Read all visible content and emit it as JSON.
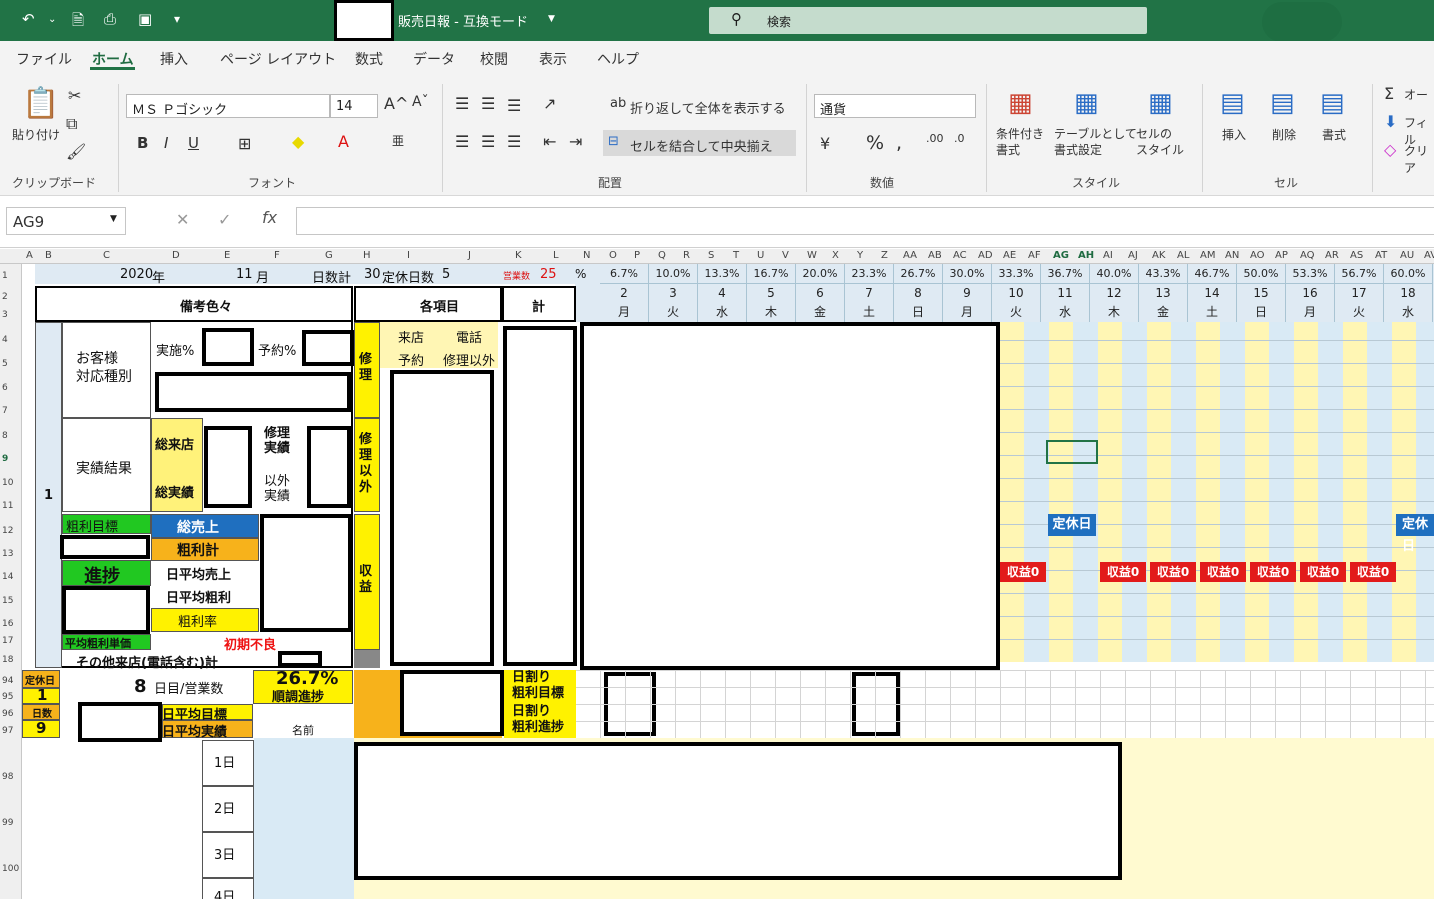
{
  "titlebar": {
    "doc_title": "販売日報  -  互換モード",
    "search_placeholder": "検索"
  },
  "tabs": [
    "ファイル",
    "ホーム",
    "挿入",
    "ページ レイアウト",
    "数式",
    "データ",
    "校閲",
    "表示",
    "ヘルプ"
  ],
  "ribbon": {
    "clipboard": {
      "paste": "貼り付け",
      "group": "クリップボード"
    },
    "font": {
      "name": "ＭＳ Ｐゴシック",
      "size": "14",
      "bold": "B",
      "italic": "I",
      "underline": "U",
      "group": "フォント"
    },
    "align": {
      "wrap": "折り返して全体を表示する",
      "merge": "セルを結合して中央揃え",
      "group": "配置"
    },
    "number": {
      "format": "通貨",
      "group": "数値"
    },
    "style": {
      "cond": "条件付き\n書式",
      "table": "テーブルとして\n書式設定",
      "cell": "セルの\nスタイル",
      "group": "スタイル"
    },
    "cells": {
      "insert": "挿入",
      "delete": "削除",
      "format": "書式",
      "group": "セル"
    },
    "edit": {
      "autosum": "オー",
      "fill": "フィル",
      "clear": "クリア"
    }
  },
  "formula": {
    "namebox": "AG9",
    "fx": "fx"
  },
  "cols": [
    "A",
    "B",
    "C",
    "D",
    "E",
    "F",
    "G",
    "H",
    "I",
    "J",
    "K",
    "L",
    "N",
    "O",
    "P",
    "Q",
    "R",
    "S",
    "T",
    "U",
    "V",
    "W",
    "X",
    "Y",
    "Z",
    "AA",
    "AB",
    "AC",
    "AD",
    "AE",
    "AF",
    "AG",
    "AH",
    "AI",
    "AJ",
    "AK",
    "AL",
    "AM",
    "AN",
    "AO",
    "AP",
    "AQ",
    "AR",
    "AS",
    "AT",
    "AU",
    "AV"
  ],
  "rows": [
    "1",
    "2",
    "3",
    "4",
    "5",
    "6",
    "7",
    "8",
    "9",
    "10",
    "11",
    "12",
    "13",
    "14",
    "15",
    "16",
    "17",
    "18",
    "94",
    "95",
    "96",
    "97",
    "98",
    "99",
    "100"
  ],
  "sheet": {
    "year": "2020",
    "year_u": "年",
    "month": "11",
    "month_u": "月",
    "daily": "日数計",
    "holidays": "30",
    "hol_label": "定休日数",
    "hol_val": "5",
    "biz_label": "営業数",
    "biz_val": "25",
    "remarks": "備考色々",
    "items": "各項目",
    "total": "計",
    "customer": "お客様\n対応種別",
    "impl": "実施%",
    "resv": "予約%",
    "results": "実績結果",
    "total_visit": "総来店",
    "total_result": "総実績",
    "repair_result": "修理\n実績",
    "other_result": "以外\n実績",
    "gp_target": "粗利目標",
    "sales": "総売上",
    "gp_total": "粗利計",
    "progress": "進捗",
    "avg_sales": "日平均売上",
    "avg_gp": "日平均粗利",
    "gp_rate": "粗利率",
    "avg_unit": "平均粗利単価",
    "initial_bad": "初期不良",
    "other_visits": "その他来店(電話含む)計",
    "repair": "修\n理",
    "non_repair": "修\n理\n以\n外",
    "revenue": "収\n益",
    "visit": "来店",
    "phone": "電話",
    "reserve": "予約",
    "non_repair_item": "修理以外",
    "row_num": "1",
    "hol_day": "定休日",
    "hol_num": "1",
    "days_label": "日数",
    "days_num": "9",
    "eight": "8",
    "biz_days": "日目/営業数",
    "pct": "26.7%",
    "on_track": "順調進捗",
    "avg_target": "日平均目標",
    "avg_actual": "日平均実績",
    "name": "名前",
    "daily_gp_target": "日割り\n粗利目標",
    "daily_gp_prog": "日割り\n粗利進捗",
    "d1": "1日",
    "d2": "2日",
    "d3": "3日",
    "d4": "4日",
    "teikyu": "定休日",
    "rev0": "収益0"
  },
  "days": [
    {
      "pct": "6.7%",
      "d": "2",
      "w": "月"
    },
    {
      "pct": "10.0%",
      "d": "3",
      "w": "火"
    },
    {
      "pct": "13.3%",
      "d": "4",
      "w": "水"
    },
    {
      "pct": "16.7%",
      "d": "5",
      "w": "木"
    },
    {
      "pct": "20.0%",
      "d": "6",
      "w": "金"
    },
    {
      "pct": "23.3%",
      "d": "7",
      "w": "土"
    },
    {
      "pct": "26.7%",
      "d": "8",
      "w": "日"
    },
    {
      "pct": "30.0%",
      "d": "9",
      "w": "月"
    },
    {
      "pct": "33.3%",
      "d": "10",
      "w": "火"
    },
    {
      "pct": "36.7%",
      "d": "11",
      "w": "水"
    },
    {
      "pct": "40.0%",
      "d": "12",
      "w": "木"
    },
    {
      "pct": "43.3%",
      "d": "13",
      "w": "金"
    },
    {
      "pct": "46.7%",
      "d": "14",
      "w": "土"
    },
    {
      "pct": "50.0%",
      "d": "15",
      "w": "日"
    },
    {
      "pct": "53.3%",
      "d": "16",
      "w": "月"
    },
    {
      "pct": "56.7%",
      "d": "17",
      "w": "火"
    },
    {
      "pct": "60.0%",
      "d": "18",
      "w": "水"
    }
  ]
}
